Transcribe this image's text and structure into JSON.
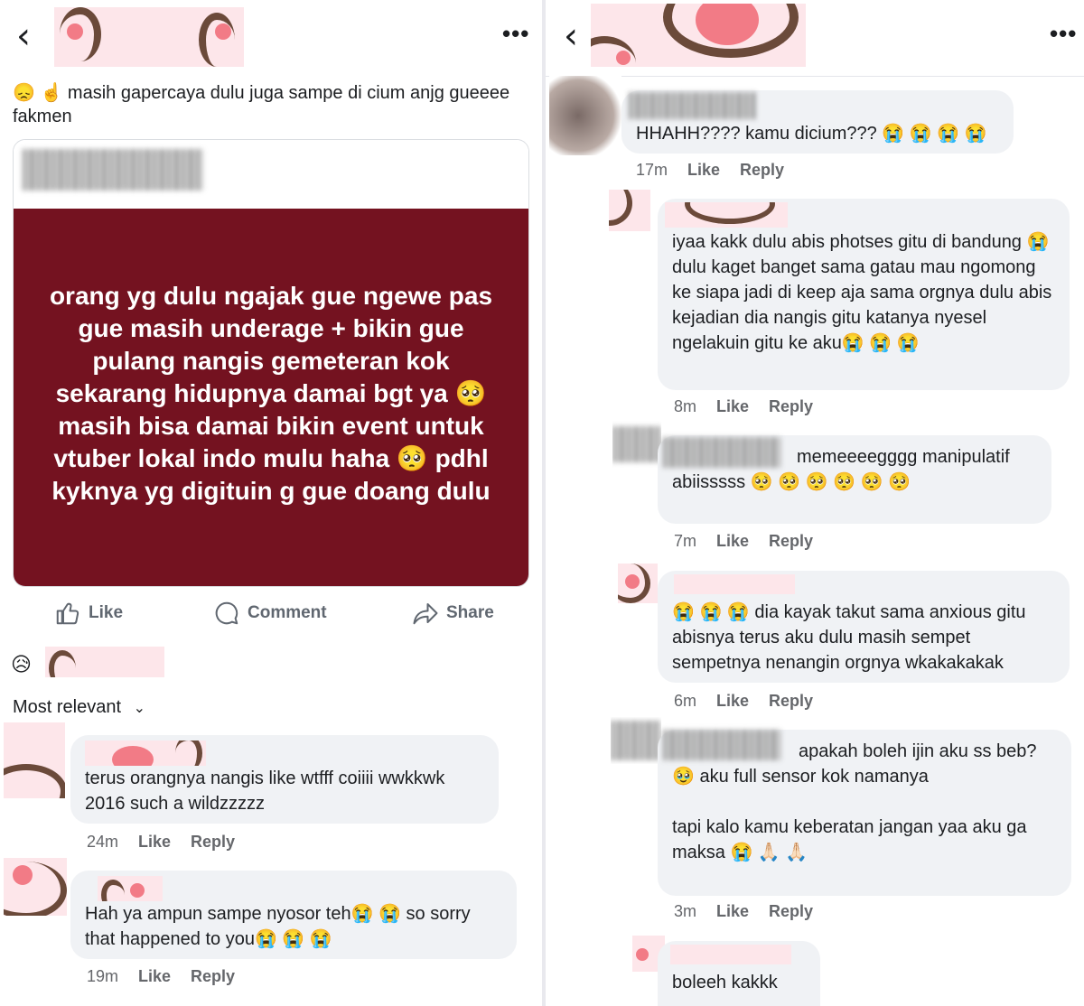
{
  "left": {
    "post_text": "😞 ☝️ masih gapercaya dulu juga sampe di cium anjg gueeee fakmen",
    "shared_text": "orang yg dulu ngajak gue ngewe pas gue masih underage + bikin gue pulang nangis gemeteran kok sekarang hidupnya damai bgt ya 🥺 masih bisa damai bikin event untuk vtuber lokal indo mulu haha 🥺 pdhl kyknya yg digituin g gue doang dulu",
    "actions": {
      "like": "Like",
      "comment": "Comment",
      "share": "Share"
    },
    "reaction_emoji": "😥",
    "sort_label": "Most relevant",
    "comments": [
      {
        "text": "terus orangnya nangis like wtfff coiiii wwkkwk 2016 such a wildzzzzz",
        "time": "24m",
        "like": "Like",
        "reply": "Reply"
      },
      {
        "text": "Hah ya ampun sampe nyosor teh😭 😭 so sorry that happened to you😭 😭 😭",
        "time": "19m",
        "like": "Like",
        "reply": "Reply"
      }
    ]
  },
  "right": {
    "comments": [
      {
        "text": "HHAHH???? kamu dicium??? 😭 😭 😭 😭",
        "time": "17m",
        "like": "Like",
        "reply": "Reply"
      },
      {
        "text": "iyaa kakk dulu abis photses gitu di bandung 😭 dulu kaget banget sama gatau mau ngomong ke siapa jadi di keep aja sama orgnya dulu abis kejadian dia nangis gitu katanya nyesel ngelakuin gitu ke aku😭 😭 😭",
        "time": "8m",
        "like": "Like",
        "reply": "Reply"
      },
      {
        "text_a": "memeeeegggg manipulatif",
        "text_b": "abiisssss 🥺 🥺 🥺 🥺 🥺 🥺",
        "time": "7m",
        "like": "Like",
        "reply": "Reply"
      },
      {
        "text": "😭 😭 😭 dia kayak takut sama anxious gitu abisnya terus aku dulu masih sempet sempetnya nenangin orgnya wkakakakak",
        "time": "6m",
        "like": "Like",
        "reply": "Reply"
      },
      {
        "text_a": "apakah boleh ijin aku ss beb?",
        "text_b": "🥹 aku full sensor kok namanya",
        "text_c": "tapi kalo kamu keberatan jangan yaa aku ga maksa 😭 🙏🏻 🙏🏻",
        "time": "3m",
        "like": "Like",
        "reply": "Reply"
      },
      {
        "text": "boleeh kakkk"
      }
    ]
  },
  "colors": {
    "shared_bg": "#741220",
    "bubble_bg": "#f0f2f5",
    "meta_text": "#65676b",
    "censor_pink": "#fde6ea",
    "censor_brown": "#6b4a3a"
  },
  "icons": [
    "back-icon",
    "more-icon",
    "like-icon",
    "comment-icon",
    "share-icon",
    "chevron-down-icon"
  ]
}
